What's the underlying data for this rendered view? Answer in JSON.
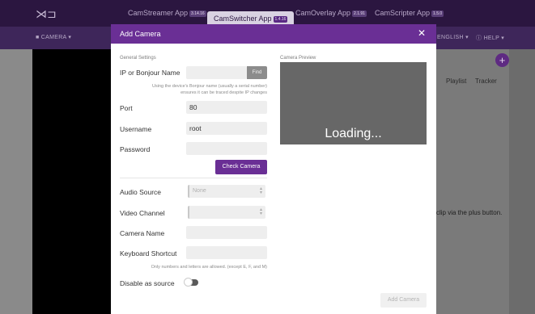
{
  "app": {
    "logo_glyph": "⋊⊐",
    "tabs": [
      {
        "label": "CamStreamer App",
        "version": "3.14.16"
      },
      {
        "label": "CamSwitcher App",
        "version": "1.4.16"
      },
      {
        "label": "CamOverlay App",
        "version": "2.1.91"
      },
      {
        "label": "CamScripter App",
        "version": "1.5.0"
      }
    ],
    "subbar": {
      "camera": "CAMERA",
      "language": "ENGLISH",
      "help": "HELP"
    },
    "plus_glyph": "+",
    "columns": [
      "Playlist",
      "Tracker"
    ],
    "hint": "clip via the plus button."
  },
  "modal": {
    "title": "Add Camera",
    "close_glyph": "✕",
    "general_settings": "General Settings",
    "ip_label": "IP or Bonjour Name",
    "ip_value": "",
    "find_label": "Find",
    "bonjour_hint_line1": "Using the device's Bonjour name (usually a serial number)",
    "bonjour_hint_line2": "ensures it can be traced despite IP changes",
    "port_label": "Port",
    "port_value": "80",
    "username_label": "Username",
    "username_value": "root",
    "password_label": "Password",
    "password_value": "",
    "check_label": "Check Camera",
    "audio_label": "Audio Source",
    "audio_value": "None",
    "video_label": "Video Channel",
    "video_value": "",
    "camera_name_label": "Camera Name",
    "camera_name_value": "",
    "shortcut_label": "Keyboard Shortcut",
    "shortcut_value": "",
    "shortcut_hint": "Only numbers and letters are allowed. (except E, F, and M)",
    "disable_label": "Disable as source",
    "disable_on": false,
    "preview_label": "Camera Preview",
    "loading_text": "Loading...",
    "add_label": "Add Camera"
  },
  "colors": {
    "brand_purple": "#6a2f95",
    "topbar": "#2b1640"
  }
}
